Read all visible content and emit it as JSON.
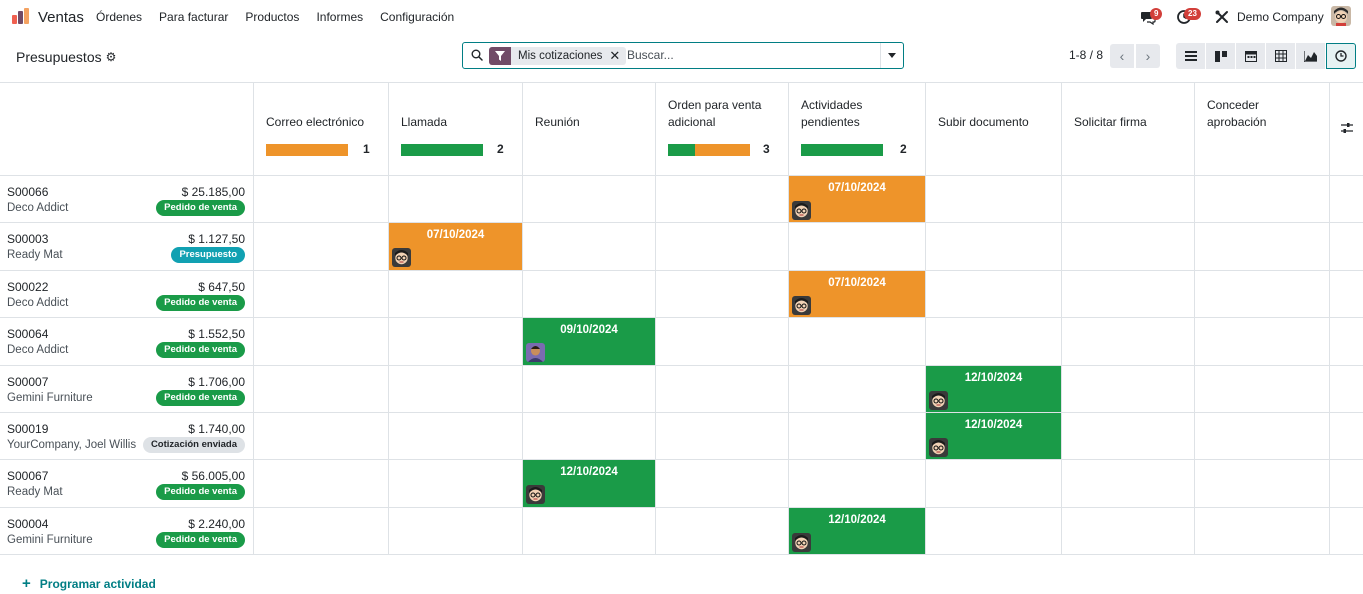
{
  "navbar": {
    "app_name": "Ventas",
    "menu": [
      "Órdenes",
      "Para facturar",
      "Productos",
      "Informes",
      "Configuración"
    ],
    "messages_count": "9",
    "activities_count": "23",
    "company": "Demo Company"
  },
  "control_panel": {
    "title": "Presupuestos",
    "facet_label": "Mis cotizaciones",
    "search_placeholder": "Buscar...",
    "pager": "1-8 / 8"
  },
  "colors": {
    "orange": "#ee942a",
    "green": "#1a9b48",
    "teal": "#11a1b2",
    "grey_badge": "#dee2e6",
    "accent": "#017e84",
    "brand": "#714b67"
  },
  "columns": [
    {
      "title_lines": [
        "Correo electrónico"
      ],
      "count": "1",
      "progress": {
        "green": 0,
        "orange": 1
      }
    },
    {
      "title_lines": [
        "Llamada"
      ],
      "count": "2",
      "progress": {
        "green": 1,
        "orange": 0
      }
    },
    {
      "title_lines": [
        "Reunión"
      ],
      "count": "",
      "progress": null
    },
    {
      "title_lines": [
        "Orden para venta",
        "adicional"
      ],
      "count": "3",
      "progress": {
        "green": 0.33,
        "orange": 0.67
      }
    },
    {
      "title_lines": [
        "Actividades",
        "pendientes"
      ],
      "count": "2",
      "progress": {
        "green": 1,
        "orange": 0
      }
    },
    {
      "title_lines": [
        "Subir documento"
      ],
      "count": "",
      "progress": null
    },
    {
      "title_lines": [
        "Solicitar firma"
      ],
      "count": "",
      "progress": null
    },
    {
      "title_lines": [
        "Conceder",
        "aprobación"
      ],
      "count": "",
      "progress": null
    }
  ],
  "rows": [
    {
      "name": "S00066",
      "amount": "$ 25.185,00",
      "partner": "Deco Addict",
      "status": "Pedido de venta",
      "status_type": "green",
      "activity": {
        "col": 3,
        "date": "07/10/2024",
        "color": "orange",
        "avatar": "glasses"
      }
    },
    {
      "name": "S00003",
      "amount": "$ 1.127,50",
      "partner": "Ready Mat",
      "status": "Presupuesto",
      "status_type": "teal",
      "activity": {
        "col": 0,
        "date": "07/10/2024",
        "color": "orange",
        "avatar": "glasses"
      }
    },
    {
      "name": "S00022",
      "amount": "$ 647,50",
      "partner": "Deco Addict",
      "status": "Pedido de venta",
      "status_type": "green",
      "activity": {
        "col": 3,
        "date": "07/10/2024",
        "color": "orange",
        "avatar": "glasses"
      }
    },
    {
      "name": "S00064",
      "amount": "$ 1.552,50",
      "partner": "Deco Addict",
      "status": "Pedido de venta",
      "status_type": "green",
      "activity": {
        "col": 1,
        "date": "09/10/2024",
        "color": "green",
        "avatar": "other"
      }
    },
    {
      "name": "S00007",
      "amount": "$ 1.706,00",
      "partner": "Gemini Furniture",
      "status": "Pedido de venta",
      "status_type": "green",
      "activity": {
        "col": 4,
        "date": "12/10/2024",
        "color": "green",
        "avatar": "glasses"
      }
    },
    {
      "name": "S00019",
      "amount": "$ 1.740,00",
      "partner": "YourCompany, Joel Willis",
      "status": "Cotización enviada",
      "status_type": "grey",
      "activity": {
        "col": 4,
        "date": "12/10/2024",
        "color": "green",
        "avatar": "glasses"
      }
    },
    {
      "name": "S00067",
      "amount": "$ 56.005,00",
      "partner": "Ready Mat",
      "status": "Pedido de venta",
      "status_type": "green",
      "activity": {
        "col": 1,
        "date": "12/10/2024",
        "color": "green",
        "avatar": "glasses"
      }
    },
    {
      "name": "S00004",
      "amount": "$ 2.240,00",
      "partner": "Gemini Furniture",
      "status": "Pedido de venta",
      "status_type": "green",
      "activity": {
        "col": 3,
        "date": "12/10/2024",
        "color": "green",
        "avatar": "glasses"
      }
    }
  ],
  "footer": {
    "add_activity": "Programar actividad"
  },
  "icons": [
    "odoo-logo-icon",
    "chat-icon",
    "clock-icon",
    "tools-icon",
    "gear-icon",
    "search-icon",
    "filter-icon",
    "close-icon",
    "caret-down-icon",
    "chevron-left-icon",
    "chevron-right-icon",
    "list-view-icon",
    "kanban-view-icon",
    "calendar-view-icon",
    "pivot-view-icon",
    "graph-view-icon",
    "activity-view-icon",
    "sliders-icon",
    "plus-icon"
  ]
}
